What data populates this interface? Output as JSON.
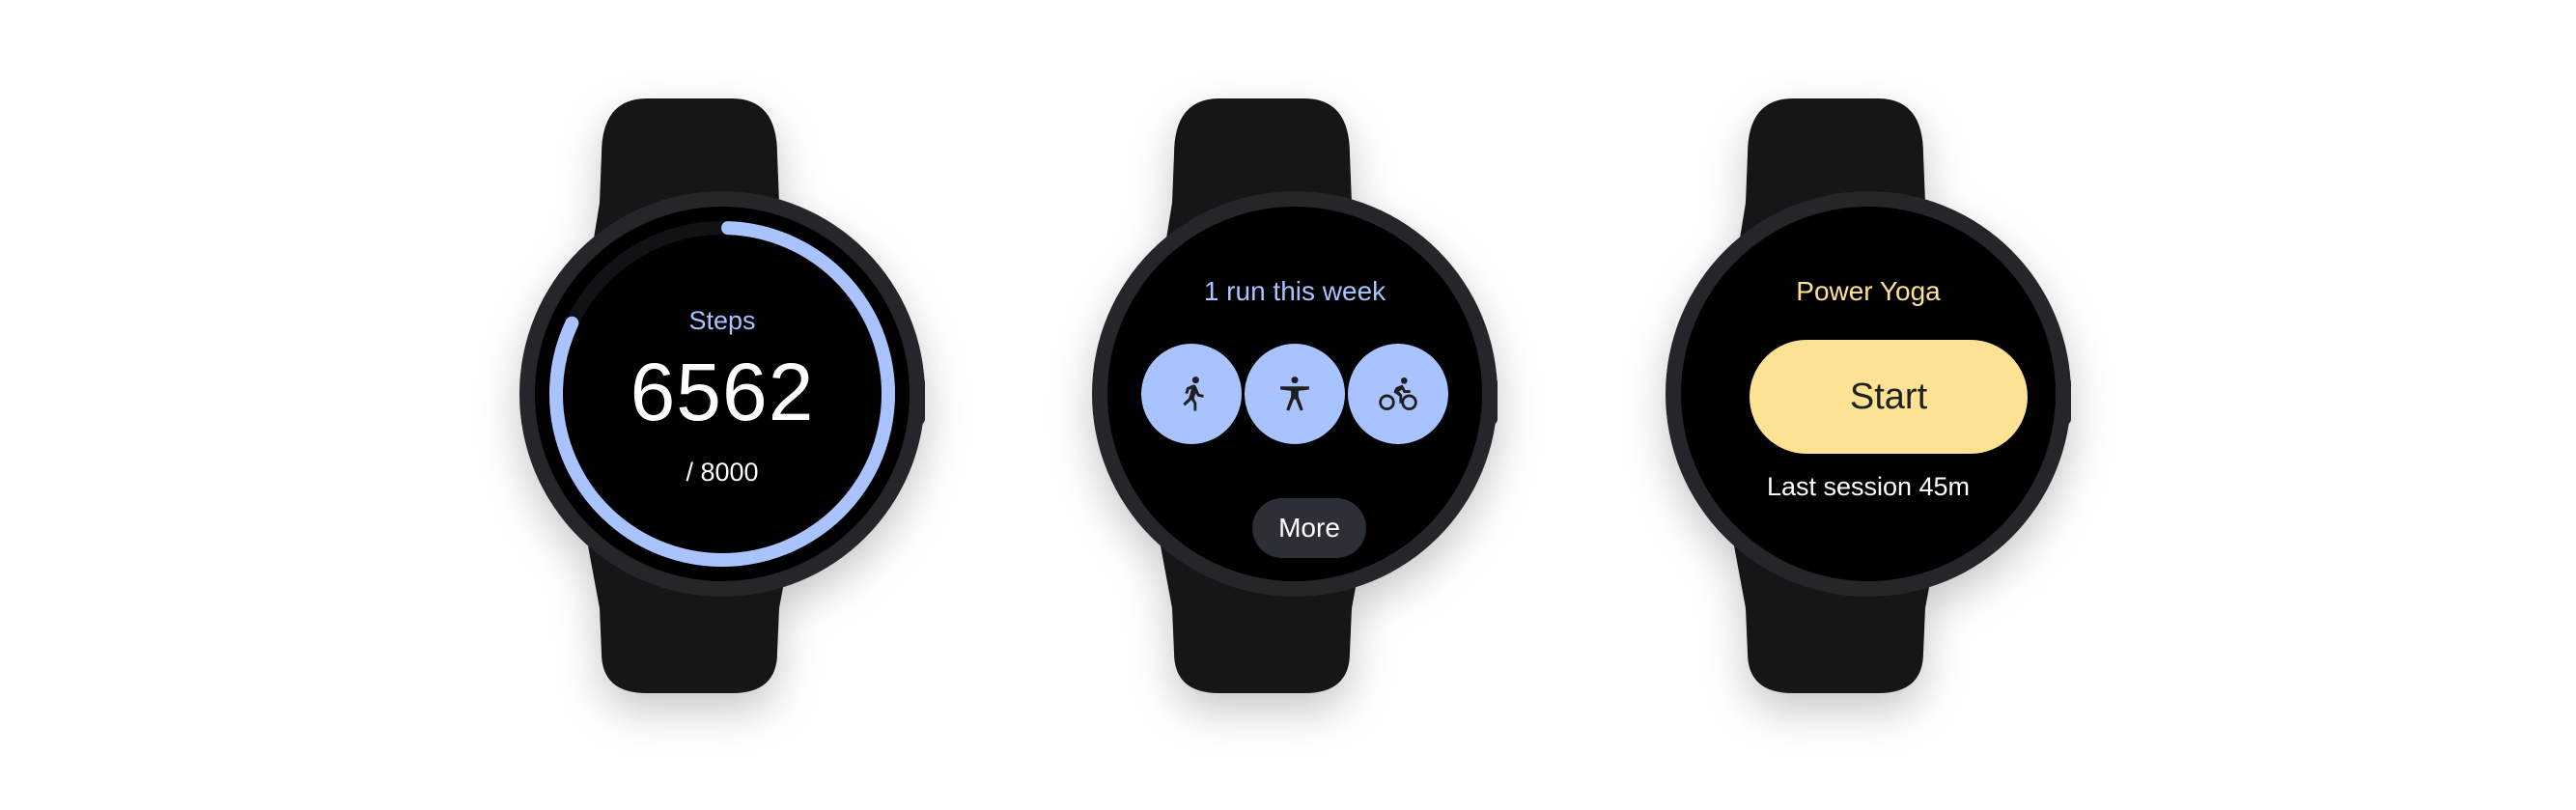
{
  "colors": {
    "strap": "#141414",
    "case": "#25262a",
    "screen": "#000000",
    "accent_blue": "#a9c3ff",
    "accent_yellow": "#fde293",
    "chip": "#2c2f36"
  },
  "steps_tile": {
    "label": "Steps",
    "value": "6562",
    "goal": "/ 8000",
    "progress_fraction": 0.82
  },
  "activity_tile": {
    "title": "1 run this week",
    "activities": [
      {
        "name": "running",
        "icon": "run-icon"
      },
      {
        "name": "yoga",
        "icon": "yoga-icon"
      },
      {
        "name": "cycling",
        "icon": "bike-icon"
      }
    ],
    "more_label": "More"
  },
  "workout_tile": {
    "title": "Power Yoga",
    "start_label": "Start",
    "last_session": "Last session 45m"
  }
}
